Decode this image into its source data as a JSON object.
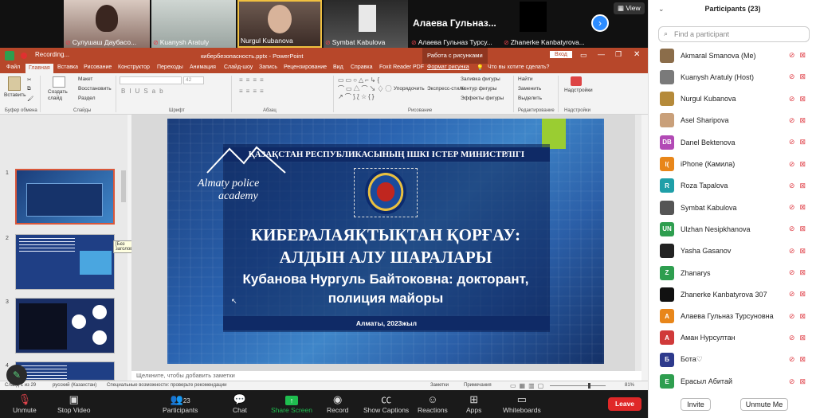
{
  "video_strip": {
    "tiles": [
      {
        "name": "Сулушаш Даубасо..."
      },
      {
        "name": "Kuanysh Aratuly"
      },
      {
        "name": "Nurgul Kubanova"
      },
      {
        "name": "Symbat Kabulova"
      },
      {
        "name": "Алаева Гульназ Турсу..."
      },
      {
        "name": "Zhanerke Kanbatyrova..."
      }
    ],
    "big_name": "Алаева Гульназ...",
    "view_label": "View",
    "recording_label": "Recording..."
  },
  "powerpoint": {
    "window_title": "кибербезопасность.pptx - PowerPoint",
    "context_tab": "Работа с рисунками",
    "login": "Вход",
    "tabs": [
      "Файл",
      "Главная",
      "Вставка",
      "Рисование",
      "Конструктор",
      "Переходы",
      "Анимация",
      "Слайд-шоу",
      "Запись",
      "Рецензирование",
      "Вид",
      "Справка",
      "Foxit Reader PDF",
      "Формат рисунка"
    ],
    "tell_me": "Что вы хотите сделать?",
    "groups": [
      "Буфер обмена",
      "Слайды",
      "Шрифт",
      "Абзац",
      "Рисование",
      "Редактирование",
      "Надстройки"
    ],
    "buttons": {
      "paste": "Вставить",
      "create_slide": "Создать слайд",
      "layout": "Макет",
      "reset": "Восстановить",
      "section": "Раздел",
      "arrange": "Упорядочить",
      "express_styles": "Экспресс-стили",
      "fill": "Заливка фигуры",
      "outline": "Контур фигуры",
      "effects": "Эффекты фигуры",
      "find": "Найти",
      "replace": "Заменить",
      "select": "Выделить",
      "addins": "Надстройки"
    },
    "font_size": "42",
    "slide_numbers": [
      "1",
      "2",
      "3",
      "4"
    ],
    "tooltip": "[Без заголовка]",
    "notes_placeholder": "Щелкните, чтобы добавить заметки",
    "status": {
      "slide": "Слайд 1 из 29",
      "lang": "русский (Казахстан)",
      "access": "Специальные возможности: проверьте рекомендации",
      "notes": "Заметки",
      "comments": "Примечания",
      "zoom": "81%"
    }
  },
  "slide": {
    "ministry": "ҚАЗАҚСТАН РЕСПУБЛИКАСЫНЫҢ ІШКІ ІСТЕР МИНИСТРЛІГІ",
    "academy_line1": "Almaty police",
    "academy_line2": "academy",
    "title_line1": "КИБЕРАЛАЯҚТЫҚТАН ҚОРҒАУ:",
    "title_line2": "АЛДЫН АЛУ ШАРАЛАРЫ",
    "subtitle_line1": "Кубанова Нургуль Байтоковна: докторант,",
    "subtitle_line2": "полиция майоры",
    "footer": "Алматы, 2023жыл"
  },
  "participants": {
    "header": "Participants (23)",
    "search_placeholder": "Find a participant",
    "list": [
      {
        "initials": "",
        "name": "Akmaral Smanova (Me)",
        "color": "#8b6d4a"
      },
      {
        "initials": "",
        "name": "Kuanysh Aratuly (Host)",
        "color": "#7a7a7a"
      },
      {
        "initials": "",
        "name": "Nurgul Kubanova",
        "color": "#b58a3a"
      },
      {
        "initials": "",
        "name": "Asel Sharipova",
        "color": "#c9a07a"
      },
      {
        "initials": "DB",
        "name": "Danel Bektenova",
        "color": "#b24ab5"
      },
      {
        "initials": "I(",
        "name": "iPhone (Камила)",
        "color": "#e8861a"
      },
      {
        "initials": "R",
        "name": "Roza Tapalova",
        "color": "#1f9fa8"
      },
      {
        "initials": "",
        "name": "Symbat Kabulova",
        "color": "#555555"
      },
      {
        "initials": "UN",
        "name": "Ulzhan Nesipkhanova",
        "color": "#2e9e4f"
      },
      {
        "initials": "",
        "name": "Yasha Gasanov",
        "color": "#222222"
      },
      {
        "initials": "Z",
        "name": "Zhanarys",
        "color": "#2e9e4f"
      },
      {
        "initials": "",
        "name": "Zhanerke Kanbatyrova 307",
        "color": "#111111"
      },
      {
        "initials": "А",
        "name": "Алаева Гульназ Турсуновна",
        "color": "#e8861a"
      },
      {
        "initials": "А",
        "name": "Аман Нурсултан",
        "color": "#d03a3a"
      },
      {
        "initials": "Б",
        "name": "Бота♡",
        "color": "#2d3a8c"
      },
      {
        "initials": "Е",
        "name": "Ерасыл Абитай",
        "color": "#2e9e4f"
      }
    ],
    "invite": "Invite",
    "unmute_me": "Unmute Me"
  },
  "toolbar": {
    "unmute": "Unmute",
    "stop_video": "Stop Video",
    "participants": "Participants",
    "participants_count": "23",
    "chat": "Chat",
    "share_screen": "Share Screen",
    "record": "Record",
    "captions": "Show Captions",
    "reactions": "Reactions",
    "apps": "Apps",
    "whiteboards": "Whiteboards",
    "leave": "Leave"
  },
  "colors": {
    "ppt_accent": "#b7472a",
    "zoom_blue": "#2d8cff",
    "share_green": "#1fbe4f",
    "leave_red": "#e02828"
  }
}
